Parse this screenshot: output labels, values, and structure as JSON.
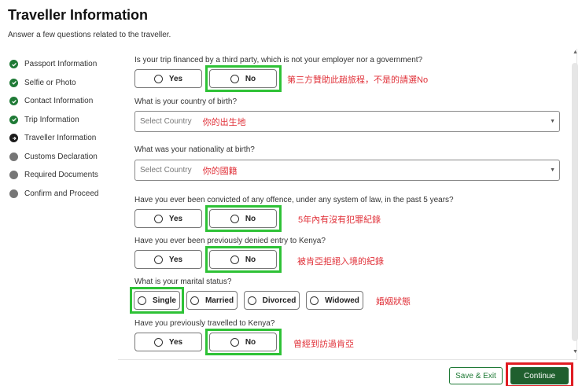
{
  "header": {
    "title": "Traveller Information",
    "subtitle": "Answer a few questions related to the traveller."
  },
  "steps": [
    {
      "label": "Passport Information",
      "status": "done"
    },
    {
      "label": "Selfie or Photo",
      "status": "done"
    },
    {
      "label": "Contact Information",
      "status": "done"
    },
    {
      "label": "Trip Information",
      "status": "done"
    },
    {
      "label": "Traveller Information",
      "status": "current"
    },
    {
      "label": "Customs Declaration",
      "status": "todo"
    },
    {
      "label": "Required Documents",
      "status": "todo"
    },
    {
      "label": "Confirm and Proceed",
      "status": "todo"
    }
  ],
  "form": {
    "q_financed": "Is your trip financed by a third party, which is not your employer nor a government?",
    "q_birth_country": "What is your country of birth?",
    "q_nationality": "What was your nationality at birth?",
    "q_convicted": "Have you ever been convicted of any offence, under any system of law, in the past 5 years?",
    "q_denied": "Have you ever been previously denied entry to Kenya?",
    "q_marital": "What is your marital status?",
    "q_travelled": "Have you previously travelled to Kenya?",
    "yes": "Yes",
    "no": "No",
    "select_placeholder": "Select Country",
    "marital_options": [
      "Single",
      "Married",
      "Divorced",
      "Widowed"
    ]
  },
  "annotations": {
    "financed": "第三方贊助此趟旅程，不是的請選No",
    "birth": "你的出生地",
    "nationality": "你的國籍",
    "convicted": "5年內有沒有犯罪紀錄",
    "denied": "被肯亞拒絕入境的紀錄",
    "marital": "婚姻狀態",
    "travelled": "曾經到訪過肯亞"
  },
  "footer": {
    "save_label": "Save & Exit",
    "continue_label": "Continue"
  },
  "colors": {
    "highlight_green": "#2ec236",
    "highlight_red": "#e01c22",
    "brand_green": "#1f7a36",
    "annotation_red": "#e03038"
  }
}
